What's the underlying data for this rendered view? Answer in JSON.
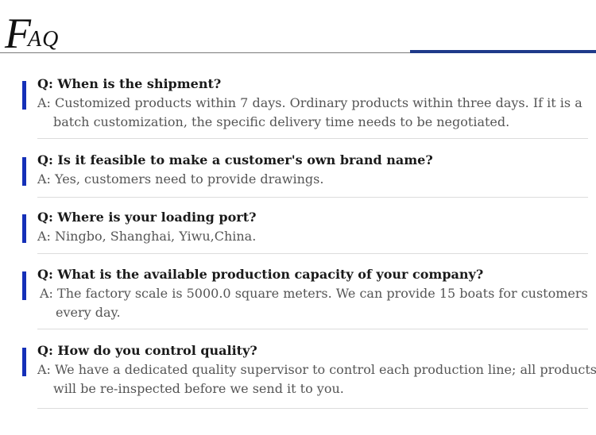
{
  "header": {
    "title_big": "F",
    "title_small": "AQ"
  },
  "faqs": [
    {
      "question": "Q: When is the shipment?",
      "answer": "A: Customized products within 7 days. Ordinary products within three days. If it is a batch customization, the specific delivery time needs to be negotiated."
    },
    {
      "question": "Q: Is it feasible to make a customer's own brand name?",
      "answer": "A: Yes, customers need to provide drawings."
    },
    {
      "question": "Q: Where is your loading port?",
      "answer": "A: Ningbo, Shanghai, Yiwu,China."
    },
    {
      "question": "Q: What is the available production capacity of your company?",
      "answer": "A: The factory scale is 5000.0 square meters. We can provide 15 boats for customers every day."
    },
    {
      "question": "Q: How do you control quality?",
      "answer": "A: We have a dedicated quality supervisor to control each production line; all products will be re-inspected before we send it to you."
    }
  ],
  "colors": {
    "accent_blue": "#1530b8",
    "rule_blue": "#1f3a8a",
    "rule_gray": "#7a7a7a"
  }
}
